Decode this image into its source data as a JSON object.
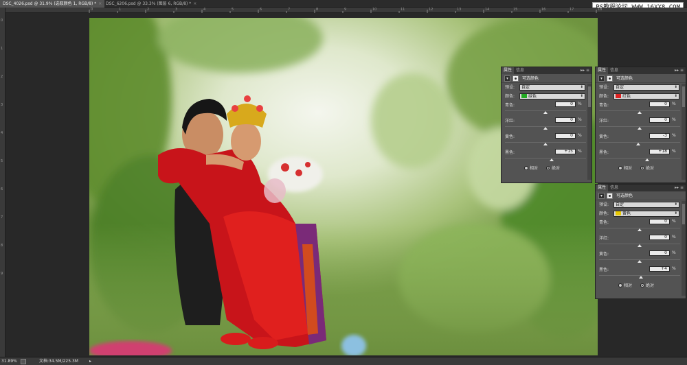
{
  "tabs": [
    {
      "label": "DSC_4026.psd @ 31.9% (选取颜色 1, RGB/8) *",
      "active": true
    },
    {
      "label": "DSC_6206.psd @ 33.3% (图层 6, RGB/8) *",
      "active": false
    }
  ],
  "watermark": "PS教程论坛 WWW.16XX8.COM",
  "ruler": {
    "top": [
      "0",
      "1",
      "2",
      "3",
      "4",
      "5",
      "6",
      "7",
      "8",
      "9",
      "10",
      "11",
      "12",
      "13",
      "14",
      "15",
      "16",
      "17",
      "18"
    ],
    "left": [
      "0",
      "1",
      "2",
      "3",
      "4",
      "5",
      "6",
      "7",
      "8",
      "9"
    ]
  },
  "status": {
    "zoom": "31.89%",
    "doc": "文档:34.5M/225.3M"
  },
  "panels": [
    {
      "tab_properties": "属性",
      "tab_info": "信息",
      "title": "可选颜色",
      "preset_label": "预设:",
      "preset_value": "自定",
      "color_label": "颜色:",
      "color_value": "绿色",
      "color_swatch": "#22aa22",
      "sliders": [
        {
          "label": "青色:",
          "value": "0",
          "unit": "%",
          "num": 0
        },
        {
          "label": "洋红:",
          "value": "0",
          "unit": "%",
          "num": 0
        },
        {
          "label": "黄色:",
          "value": "0",
          "unit": "%",
          "num": 0
        },
        {
          "label": "黑色:",
          "value": "+15",
          "unit": "%",
          "num": 15
        }
      ],
      "method_relative": "相对",
      "method_absolute": "绝对",
      "method_selected": "absolute"
    },
    {
      "tab_properties": "属性",
      "tab_info": "信息",
      "title": "可选颜色",
      "preset_label": "预设:",
      "preset_value": "自定",
      "color_label": "颜色:",
      "color_value": "红色",
      "color_swatch": "#dd2222",
      "sliders": [
        {
          "label": "青色:",
          "value": "0",
          "unit": "%",
          "num": 0
        },
        {
          "label": "洋红:",
          "value": "0",
          "unit": "%",
          "num": 0
        },
        {
          "label": "黄色:",
          "value": "-3",
          "unit": "%",
          "num": -3
        },
        {
          "label": "黑色:",
          "value": "+18",
          "unit": "%",
          "num": 18
        }
      ],
      "method_relative": "相对",
      "method_absolute": "绝对",
      "method_selected": "absolute"
    },
    {
      "tab_properties": "属性",
      "tab_info": "信息",
      "title": "可选颜色",
      "preset_label": "预设:",
      "preset_value": "自定",
      "color_label": "颜色:",
      "color_value": "黄色",
      "color_swatch": "#e8c800",
      "sliders": [
        {
          "label": "青色:",
          "value": "0",
          "unit": "%",
          "num": 0
        },
        {
          "label": "洋红:",
          "value": "0",
          "unit": "%",
          "num": 0
        },
        {
          "label": "黄色:",
          "value": "0",
          "unit": "%",
          "num": 0
        },
        {
          "label": "黑色:",
          "value": "+4",
          "unit": "%",
          "num": 4
        }
      ],
      "method_relative": "相对",
      "method_absolute": "绝对",
      "method_selected": "absolute"
    }
  ]
}
